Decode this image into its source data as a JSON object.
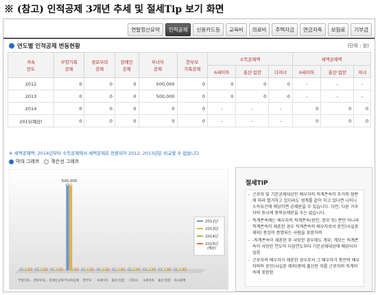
{
  "page_title": "※ (참고) 인적공제 3개년 추세 및 절세Tip 보기 화면",
  "tabs": [
    {
      "label": "연말정산요약",
      "active": false
    },
    {
      "label": "인적공제",
      "active": true
    },
    {
      "label": "신용카드등",
      "active": false
    },
    {
      "label": "교육비",
      "active": false
    },
    {
      "label": "의료비",
      "active": false
    },
    {
      "label": "주택자금",
      "active": false
    },
    {
      "label": "연금저축",
      "active": false
    },
    {
      "label": "보험료",
      "active": false
    },
    {
      "label": "기부금",
      "active": false
    }
  ],
  "section_title": "연도별 인적공제 변동현황",
  "unit_label": "(단위 : 원)",
  "table": {
    "col_year": "귀속\n연도",
    "col_dependents": "부양가족\n공제",
    "col_elderly": "경로우대\n공제",
    "col_disabled": "장애인\n공제",
    "col_woman": "부녀자\n공제",
    "col_single_parent": "한부모\n가족공제",
    "group_income": "소득공제액",
    "group_tax": "세액공제액",
    "sub_income": [
      "6세이하",
      "출산·입양",
      "다자녀"
    ],
    "sub_tax": [
      "6세이하",
      "출산·입양",
      "자녀"
    ],
    "rows": [
      {
        "year": "2012",
        "cells": [
          "0",
          "0",
          "0",
          "500,000",
          "0",
          "0",
          "0",
          "0",
          "-",
          "-",
          "-"
        ]
      },
      {
        "year": "2013",
        "cells": [
          "0",
          "0",
          "0",
          "500,000",
          "0",
          "0",
          "0",
          "0",
          "-",
          "-",
          "-"
        ]
      },
      {
        "year": "2014",
        "cells": [
          "0",
          "0",
          "0",
          "0",
          "0",
          "-",
          "-",
          "-",
          "0",
          "0",
          "0"
        ]
      },
      {
        "year": "2015(예상)",
        "cells": [
          "0",
          "0",
          "0",
          "0",
          "0",
          "-",
          "-",
          "-",
          "0",
          "0",
          "0"
        ]
      }
    ]
  },
  "footnote": "※ 세액공제액: 2014년부터 소득공제에서 세액공제로 전환되어 2012, 2013년은 비교할 수 없습니다.",
  "chart_options": {
    "bar_label": "막대 그래프",
    "line_label": "꺾은선 그래프",
    "selected": "bar"
  },
  "chart_data": {
    "type": "bar",
    "categories": [
      "부양가족",
      "경로우대",
      "장애인공제",
      "부녀자공제",
      "한부모",
      "6세이하",
      "출산·입양",
      "다자녀",
      "6세이하",
      "출산·입양",
      "자녀"
    ],
    "tick_labels": [
      "부양가족...",
      "경로우대...",
      "장애인공제",
      "부녀자공제",
      "한부모",
      "6세이하",
      "출산·입양",
      "다자녀",
      "6세이하",
      "출산·입양",
      "자녀세액"
    ],
    "series": [
      {
        "name": "2012년",
        "values": [
          0,
          0,
          0,
          500000,
          0,
          0,
          0,
          0,
          0,
          0,
          0
        ],
        "color": "#6f98c7"
      },
      {
        "name": "2013년",
        "values": [
          0,
          0,
          0,
          500000,
          0,
          0,
          0,
          0,
          0,
          0,
          0
        ],
        "color": "#e2b44a"
      },
      {
        "name": "2014년",
        "values": [
          0,
          0,
          0,
          0,
          0,
          0,
          0,
          0,
          0,
          0,
          0
        ],
        "color": "#9cc04a"
      },
      {
        "name": "2015년\n(예상)",
        "values": [
          0,
          0,
          0,
          0,
          0,
          0,
          0,
          0,
          0,
          0,
          0
        ],
        "color": "#e8743a"
      }
    ],
    "data_label": "500,000",
    "legend_position": "right"
  },
  "tip": {
    "title": "절세TIP",
    "items": [
      "근로자 및 기본공제대상인 배우자의 직계존속이 주거의 형편에 따라 별거하고 있더라도 생계를 같이 하고 있다면 나이나 소득요건에 해당하면 공제받을 수 있습니다. 다만, 다른 거주자와 동시에 중복공제받을 수는 없습니다.",
      "직계존속에는 배우자의 직계존속(장인, 장모 등) 뿐만 아니라 직계존속이 재혼한 경우 직계존속의 배우자로서 혼인(사실혼 제외) 중임이 증명되는 사람을 포함하며",
      "-직계존속이 재혼한 후 사망한 경우에도 계부, 계모는 직계존속이 사망한 연도의 다음연도부터 기본공제대상에 해당되지 않음",
      "근로자의 배우자가 재혼한 경우로서 그 배우자가 종전의 배우자와의 혼인(사실혼 제외)중에 출산한 자를 근로자의 직계비속에 포함함"
    ]
  }
}
